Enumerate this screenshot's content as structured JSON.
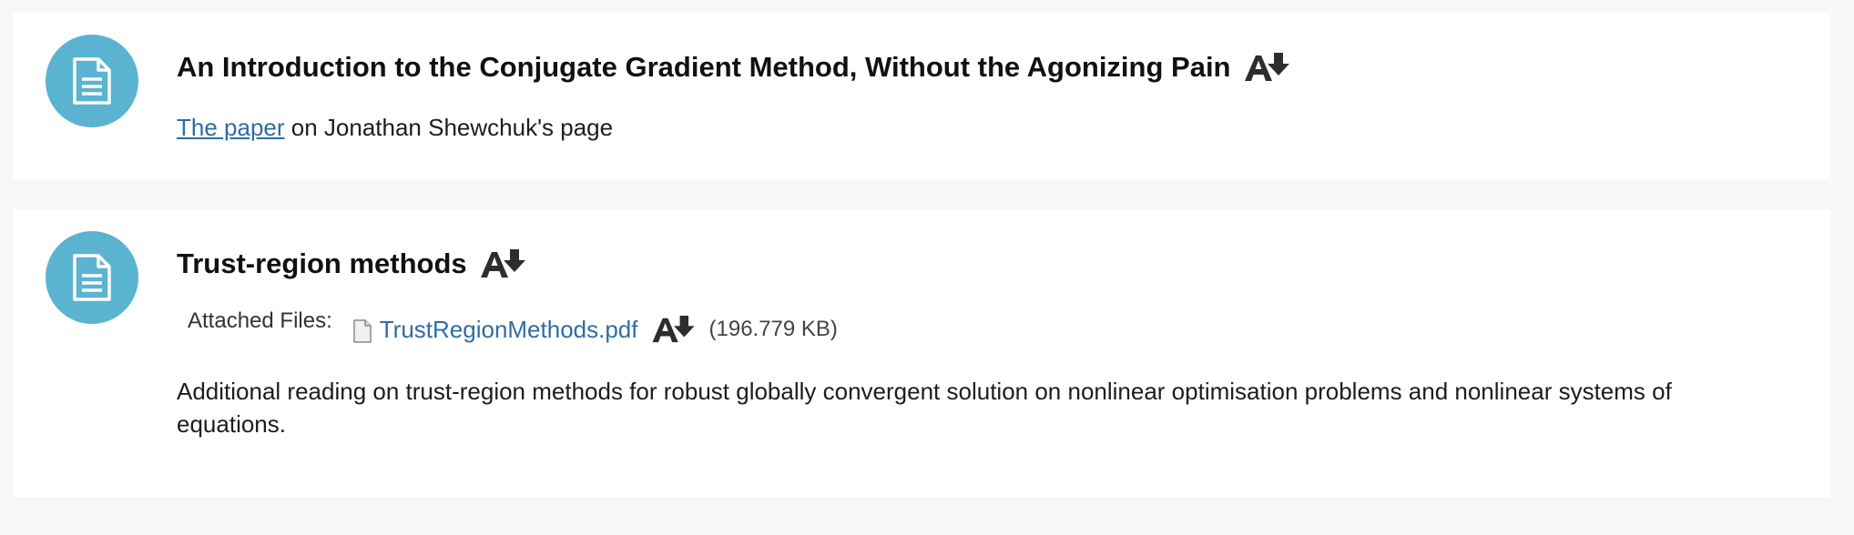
{
  "items": [
    {
      "title": "An Introduction to the Conjugate Gradient Method, Without the Agonizing Pain",
      "link_text": "The paper",
      "desc_suffix": " on Jonathan Shewchuk's page",
      "icon": "document-icon"
    },
    {
      "title": "Trust-region methods",
      "attached_label": "Attached Files:",
      "file_name": "TrustRegionMethods.pdf",
      "file_size": "(196.779 KB)",
      "description": "Additional reading on trust-region methods for robust globally convergent solution on nonlinear optimisation problems and nonlinear systems of equations.",
      "icon": "document-icon"
    }
  ],
  "colors": {
    "icon_circle": "#5ab4d1",
    "link": "#2f6da3",
    "background": "#f7f7f7",
    "card": "#ffffff"
  }
}
